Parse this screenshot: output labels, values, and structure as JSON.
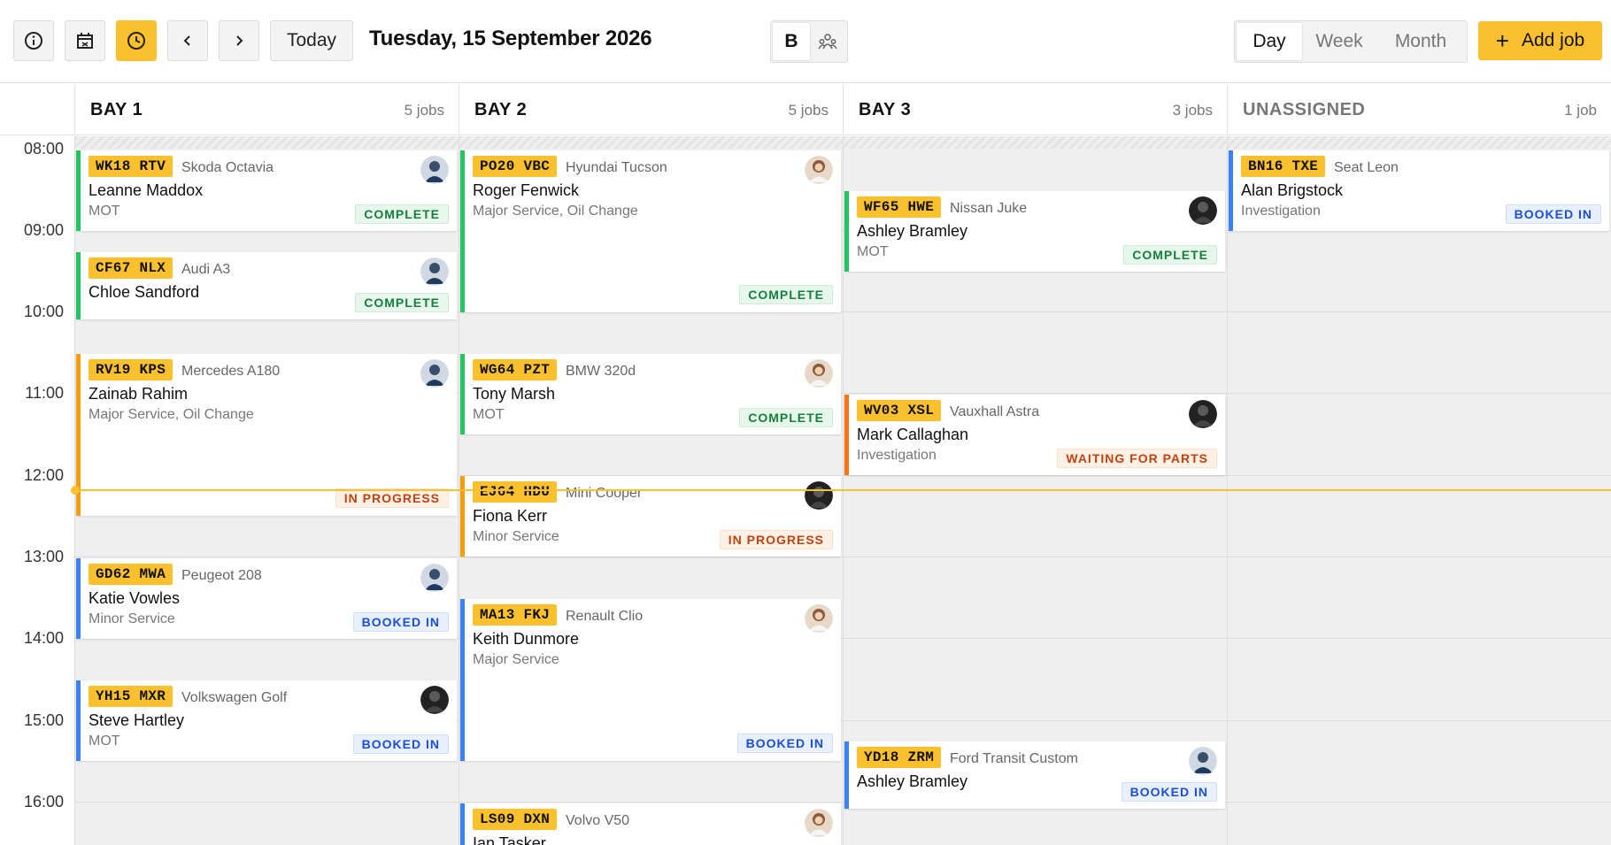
{
  "toolbar": {
    "today_label": "Today",
    "date_title": "Tuesday, 15 September 2026",
    "view_toggle_b": "B",
    "views": [
      "Day",
      "Week",
      "Month"
    ],
    "selected_view": "Day",
    "add_label": "Add job"
  },
  "columns": [
    {
      "name": "BAY 1",
      "count": "5 jobs"
    },
    {
      "name": "BAY 2",
      "count": "5 jobs"
    },
    {
      "name": "BAY 3",
      "count": "3 jobs"
    },
    {
      "name": "UNASSIGNED",
      "count": "1 job"
    }
  ],
  "times": [
    "08:00",
    "09:00",
    "10:00",
    "11:00",
    "12:00",
    "13:00",
    "14:00",
    "15:00",
    "16:00"
  ],
  "jobs": [
    {
      "plate": "WK18 RTV",
      "vehicle": "Skoda Octavia",
      "customer": "Leanne Maddox",
      "service": "MOT",
      "status": "COMPLETE"
    },
    {
      "plate": "CF67 NLX",
      "vehicle": "Audi A3",
      "customer": "Chloe Sandford",
      "service": "",
      "status": "COMPLETE"
    },
    {
      "plate": "RV19 KPS",
      "vehicle": "Mercedes A180",
      "customer": "Zainab Rahim",
      "service": "Major Service, Oil Change",
      "status": "IN PROGRESS"
    },
    {
      "plate": "GD62 MWA",
      "vehicle": "Peugeot 208",
      "customer": "Katie Vowles",
      "service": "Minor Service",
      "status": "BOOKED IN"
    },
    {
      "plate": "YH15 MXR",
      "vehicle": "Volkswagen Golf",
      "customer": "Steve Hartley",
      "service": "MOT",
      "status": "BOOKED IN"
    },
    {
      "plate": "PO20 VBC",
      "vehicle": "Hyundai Tucson",
      "customer": "Roger Fenwick",
      "service": "Major Service, Oil Change",
      "status": "COMPLETE"
    },
    {
      "plate": "WG64 PZT",
      "vehicle": "BMW 320d",
      "customer": "Tony Marsh",
      "service": "MOT",
      "status": "COMPLETE"
    },
    {
      "plate": "EJ64 HDU",
      "vehicle": "Mini Cooper",
      "customer": "Fiona Kerr",
      "service": "Minor Service",
      "status": "IN PROGRESS"
    },
    {
      "plate": "MA13 FKJ",
      "vehicle": "Renault Clio",
      "customer": "Keith Dunmore",
      "service": "Major Service",
      "status": "BOOKED IN"
    },
    {
      "plate": "LS09 DXN",
      "vehicle": "Volvo V50",
      "customer": "Ian Tasker",
      "service": "",
      "status": ""
    },
    {
      "plate": "WF65 HWE",
      "vehicle": "Nissan Juke",
      "customer": "Ashley Bramley",
      "service": "MOT",
      "status": "COMPLETE"
    },
    {
      "plate": "WV03 XSL",
      "vehicle": "Vauxhall Astra",
      "customer": "Mark Callaghan",
      "service": "Investigation",
      "status": "WAITING FOR PARTS"
    },
    {
      "plate": "YD18 ZRM",
      "vehicle": "Ford Transit Custom",
      "customer": "Ashley Bramley",
      "service": "",
      "status": "BOOKED IN"
    },
    {
      "plate": "BN16 TXE",
      "vehicle": "Seat Leon",
      "customer": "Alan Brigstock",
      "service": "Investigation",
      "status": "BOOKED IN"
    }
  ],
  "colors": {
    "accent": "#fbc02d",
    "complete": "#22c55e",
    "in_progress": "#f59e0b",
    "booked_in": "#3b82f6",
    "waiting_for_parts": "#f97316"
  }
}
